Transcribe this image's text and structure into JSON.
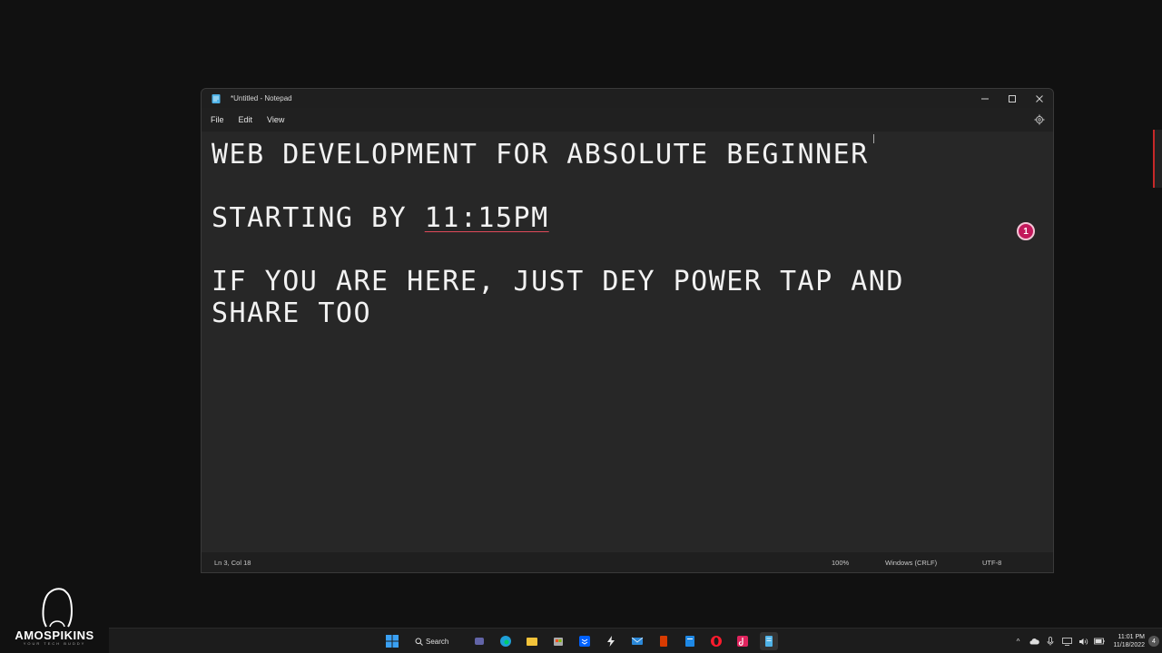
{
  "window": {
    "title": "*Untitled - Notepad",
    "minimize_icon": "minimize-icon",
    "maximize_icon": "maximize-icon",
    "close_icon": "close-icon"
  },
  "menu": {
    "file": "File",
    "edit": "Edit",
    "view": "View",
    "settings_icon": "gear-icon"
  },
  "editor": {
    "line1": "WEB DEVELOPMENT FOR ABSOLUTE BEGINNER",
    "line2_prefix": "STARTING BY ",
    "line2_time": "11:15PM",
    "line3": "IF YOU ARE HERE, JUST DEY POWER TAP AND",
    "line4": "SHARE TOO"
  },
  "status": {
    "position": "Ln 3, Col 18",
    "zoom": "100%",
    "line_ending": "Windows (CRLF)",
    "encoding": "UTF-8"
  },
  "badge": {
    "count": "1"
  },
  "logo": {
    "name": "AMOSPIKINS",
    "tagline": "YOUR TECH BUDDY"
  },
  "taskbar": {
    "search_label": "Search",
    "apps": [
      "start-icon",
      "search",
      "teams-icon",
      "edge-icon",
      "file-explorer-icon",
      "store-icon",
      "dropbox-icon",
      "bolt-icon",
      "mail-icon",
      "office-icon",
      "notes-icon",
      "opera-icon",
      "tiktok-icon",
      "notepad-icon"
    ],
    "time": "11:01 PM",
    "date": "11/18/2022",
    "notification_count": "4"
  },
  "colors": {
    "accent_red": "#e04a5a",
    "window_bg": "#272727",
    "taskbar_bg": "#1c1c1c"
  }
}
